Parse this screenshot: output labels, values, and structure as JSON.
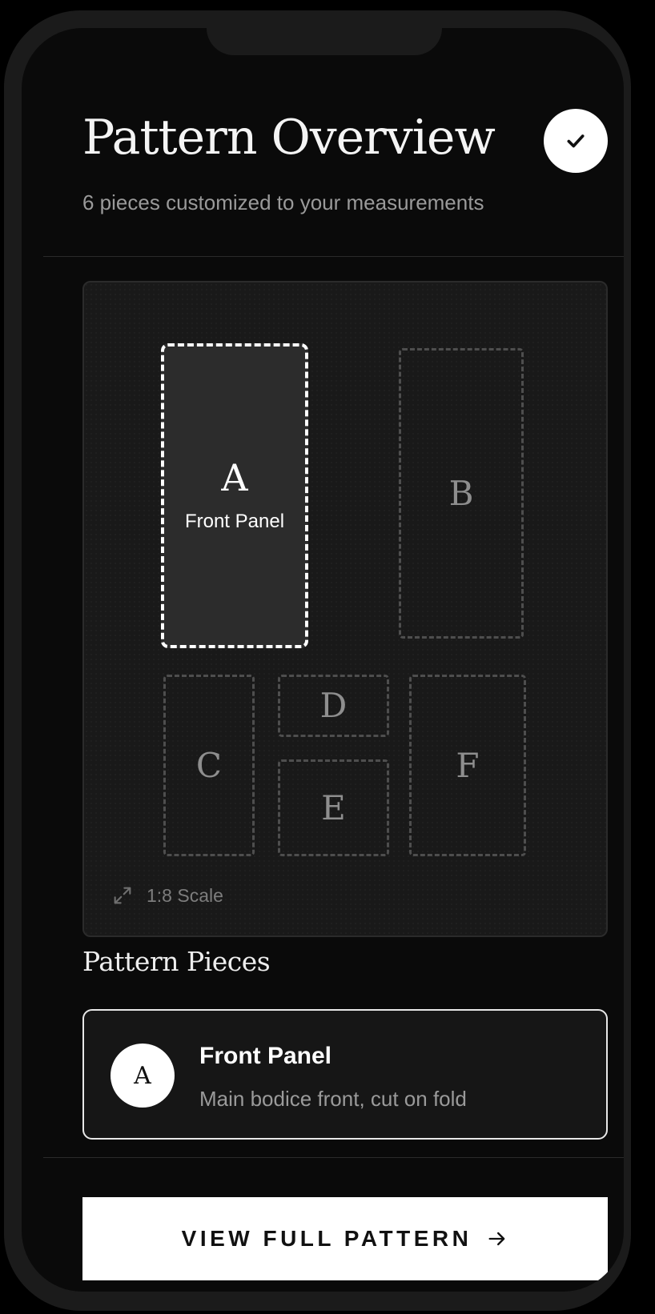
{
  "header": {
    "title": "Pattern Overview",
    "subtitle": "6 pieces customized to your measurements",
    "confirm_icon": "checkmark-icon"
  },
  "layout_canvas": {
    "pieces": [
      {
        "letter": "A",
        "label": "Front Panel",
        "selected": true
      },
      {
        "letter": "B",
        "selected": false
      },
      {
        "letter": "C",
        "selected": false
      },
      {
        "letter": "D",
        "selected": false
      },
      {
        "letter": "E",
        "selected": false
      },
      {
        "letter": "F",
        "selected": false
      }
    ],
    "scale_icon": "expand-arrows-icon",
    "scale_label": "1:8 Scale"
  },
  "pieces_section": {
    "title": "Pattern Pieces",
    "selected_piece": {
      "letter": "A",
      "name": "Front Panel",
      "description": "Main bodice front, cut on fold"
    }
  },
  "cta": {
    "label": "VIEW FULL PATTERN",
    "icon": "arrow-right-icon"
  },
  "colors": {
    "background": "#0a0a0a",
    "surface": "#191919",
    "accent": "#ffffff",
    "muted_text": "#9a9a9a"
  }
}
